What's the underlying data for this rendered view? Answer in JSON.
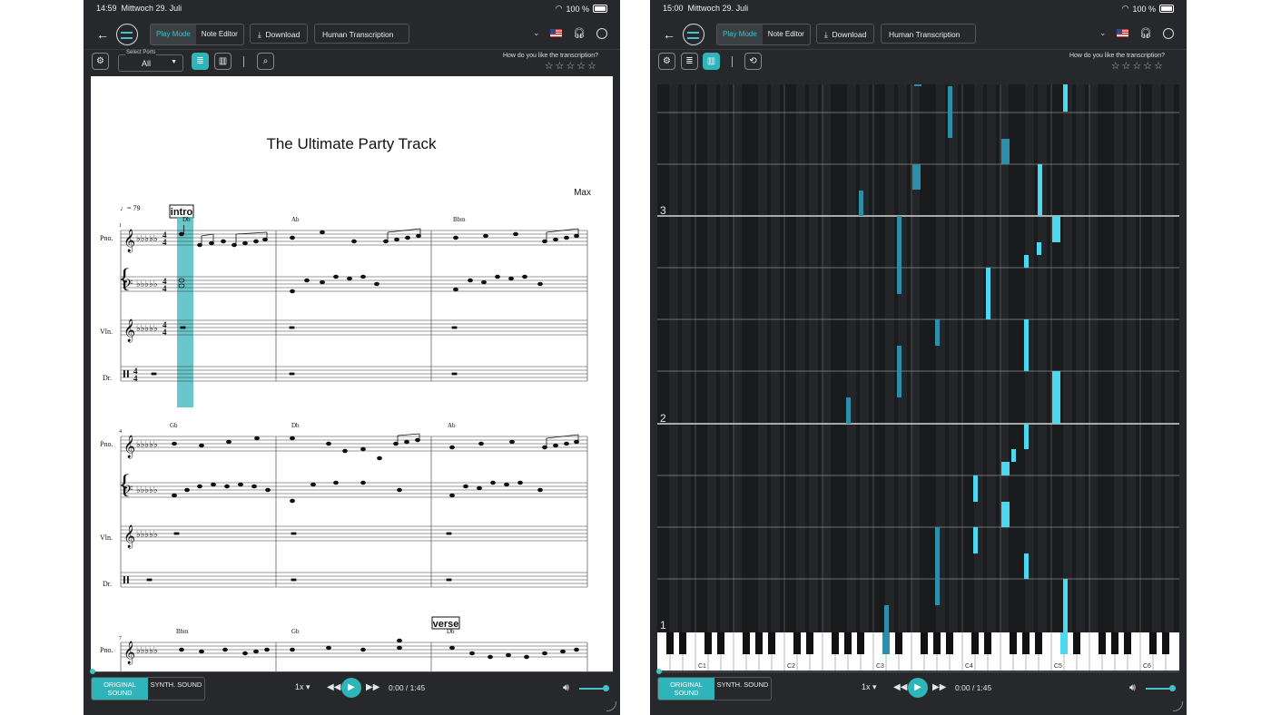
{
  "left": {
    "status": {
      "time": "14:59",
      "date": "Mittwoch 29. Juli",
      "battery": "100 %"
    },
    "header": {
      "mode_play": "Play Mode",
      "mode_editor": "Note Editor",
      "download": "Download",
      "transcription": "Human Transcription"
    },
    "ports": {
      "label": "Select Ports",
      "value": "All"
    },
    "rating": {
      "question": "How do you like the transcription?",
      "stars": "☆☆☆☆☆"
    },
    "score": {
      "title": "The Ultimate Party Track",
      "composer": "Max",
      "tempo": "= 79",
      "rehearsal_intro": "intro",
      "rehearsal_verse": "verse",
      "instruments": {
        "piano": "Pno.",
        "violin": "Vln.",
        "drums": "Dr."
      },
      "time_sig_top": "4",
      "time_sig_bottom": "4",
      "measure_numbers": [
        "1",
        "4",
        "7"
      ],
      "chords_system1": [
        "Db",
        "Ab",
        "Bbm"
      ],
      "chords_system2": [
        "Gb",
        "Db",
        "Ab"
      ],
      "chords_system3": [
        "Bbm",
        "Gb",
        "Db"
      ]
    },
    "player": {
      "original": "ORIGINAL SOUND",
      "synth": "SYNTH. SOUND",
      "speed": "1x",
      "time": "0:00 / 1:45"
    }
  },
  "right": {
    "status": {
      "time": "15:00",
      "date": "Mittwoch 29. Juli",
      "battery": "100 %"
    },
    "header": {
      "mode_play": "Play Mode",
      "mode_editor": "Note Editor",
      "download": "Download",
      "transcription": "Human Transcription"
    },
    "rating": {
      "question": "How do you like the transcription?",
      "stars": "☆☆☆☆☆"
    },
    "roll": {
      "measure_labels": [
        "3",
        "2",
        "1"
      ]
    },
    "keyboard": {
      "labels": [
        "C1",
        "C2",
        "C3",
        "C4",
        "C5",
        "C6"
      ]
    },
    "player": {
      "original": "ORIGINAL SOUND",
      "synth": "SYNTH. SOUND",
      "speed": "1x",
      "time": "0:00 / 1:45"
    }
  },
  "colors": {
    "accent": "#2fb4ba",
    "note_dark": "#2c8ea8",
    "note_bright": "#4cd9f0",
    "background": "#26282b"
  }
}
